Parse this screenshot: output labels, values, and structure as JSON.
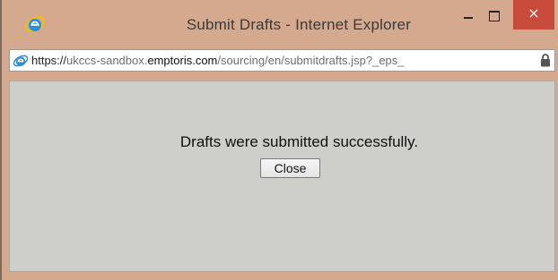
{
  "window": {
    "title": "Submit Drafts - Internet Explorer",
    "minimize_icon": "minimize-icon",
    "maximize_icon": "maximize-icon",
    "close_symbol": "×",
    "close_button_color": "#c74a3b",
    "frame_color": "#d4a98e"
  },
  "address_bar": {
    "scheme": "https://",
    "host_prefix": "ukccs-sandbox.",
    "host_domain": "emptoris.com",
    "path": "/sourcing/en/submitdrafts.jsp?_eps_",
    "browser_icon": "internet-explorer-icon",
    "lock_icon": "lock-icon"
  },
  "dialog": {
    "message": "Drafts were submitted successfully.",
    "close_label": "Close",
    "background_color": "#cececa"
  }
}
